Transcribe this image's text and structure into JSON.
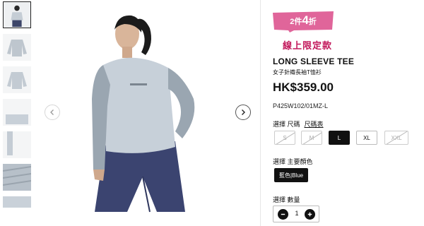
{
  "gallery": {
    "thumbnails": [
      "thumb-model-front",
      "thumb-tee-front",
      "thumb-tee-back",
      "thumb-tee-folded",
      "thumb-sleeve-detail",
      "thumb-fabric-texture",
      "thumb-fabric-close"
    ],
    "active_index": 0
  },
  "product": {
    "promo_prefix": "2件",
    "promo_number": "4",
    "promo_suffix": "折",
    "online_only": "線上限定款",
    "title": "LONG SLEEVE TEE",
    "subtitle": "女子針織長袖T恤衫",
    "price": "HK$359.00",
    "sku": "P425W102/01MZ-L"
  },
  "size": {
    "label": "選擇 尺碼",
    "chart_link": "尺碼表",
    "options": [
      {
        "label": "S",
        "state": "unavailable"
      },
      {
        "label": "M",
        "state": "unavailable"
      },
      {
        "label": "L",
        "state": "selected"
      },
      {
        "label": "XL",
        "state": "available"
      },
      {
        "label": "XXL",
        "state": "unavailable"
      }
    ]
  },
  "color": {
    "label": "選擇 主要顏色",
    "selected": "藍色|Blue"
  },
  "quantity": {
    "label": "選擇 數量",
    "value": "1"
  },
  "colors": {
    "promo_pink": "#e0659a",
    "online_only_text": "#c2185b",
    "selected_bg": "#111111"
  }
}
